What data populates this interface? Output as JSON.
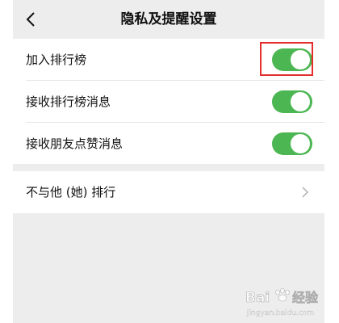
{
  "nav": {
    "title": "隐私及提醒设置",
    "back_icon": "chevron-left-icon"
  },
  "settings": [
    {
      "label": "加入排行榜",
      "enabled": true
    },
    {
      "label": "接收排行榜消息",
      "enabled": true
    },
    {
      "label": "接收朋友点赞消息",
      "enabled": true
    }
  ],
  "exclude_row": {
    "label": "不与他 (她) 排行",
    "chevron_icon": "chevron-right-icon"
  },
  "colors": {
    "toggle_on": "#4cb652",
    "highlight_border": "#e52e2e",
    "background": "#ededed"
  },
  "watermark": {
    "brand": "Baidu经验",
    "url": "jingyan.baidu.com"
  }
}
